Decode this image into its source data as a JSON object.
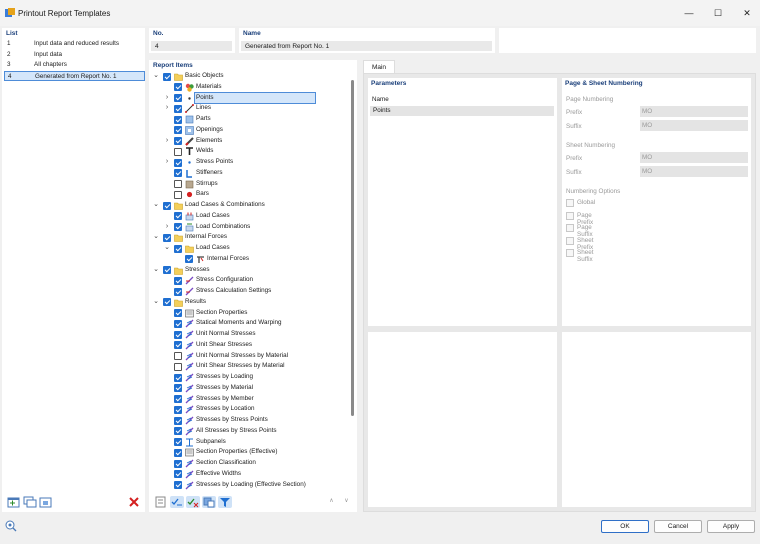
{
  "window": {
    "title": "Printout Report Templates",
    "minimize": "—",
    "maximize": "☐",
    "close": "✕"
  },
  "list": {
    "header": "List",
    "items": [
      {
        "no": "1",
        "label": "Input data and reduced results"
      },
      {
        "no": "2",
        "label": "Input data"
      },
      {
        "no": "3",
        "label": "All chapters"
      },
      {
        "no": "4",
        "label": "Generated from Report No. 1"
      }
    ],
    "selected_index": 3
  },
  "no_field": {
    "label": "No.",
    "value": "4"
  },
  "name_field": {
    "label": "Name",
    "value": "Generated from Report No. 1"
  },
  "report_items": {
    "header": "Report Items",
    "rows": [
      {
        "level": 0,
        "exp": "v",
        "checked": true,
        "icon": "folder-icon",
        "label": "Basic Objects"
      },
      {
        "level": 1,
        "exp": "",
        "checked": true,
        "icon": "materials-icon",
        "label": "Materials"
      },
      {
        "level": 1,
        "exp": ">",
        "checked": true,
        "icon": "point-icon",
        "label": "Points",
        "highlight": true
      },
      {
        "level": 1,
        "exp": ">",
        "checked": true,
        "icon": "line-icon",
        "label": "Lines"
      },
      {
        "level": 1,
        "exp": "",
        "checked": true,
        "icon": "parts-icon",
        "label": "Parts"
      },
      {
        "level": 1,
        "exp": "",
        "checked": true,
        "icon": "openings-icon",
        "label": "Openings"
      },
      {
        "level": 1,
        "exp": ">",
        "checked": true,
        "icon": "elements-icon",
        "label": "Elements"
      },
      {
        "level": 1,
        "exp": "",
        "checked": false,
        "icon": "welds-icon",
        "label": "Welds"
      },
      {
        "level": 1,
        "exp": ">",
        "checked": true,
        "icon": "stress-point-icon",
        "label": "Stress Points"
      },
      {
        "level": 1,
        "exp": "",
        "checked": true,
        "icon": "stiffeners-icon",
        "label": "Stiffeners"
      },
      {
        "level": 1,
        "exp": "",
        "checked": false,
        "icon": "stirrups-icon",
        "label": "Stirrups"
      },
      {
        "level": 1,
        "exp": "",
        "checked": false,
        "icon": "bars-icon",
        "label": "Bars"
      },
      {
        "level": 0,
        "exp": "v",
        "checked": true,
        "icon": "folder-icon",
        "label": "Load Cases & Combinations"
      },
      {
        "level": 1,
        "exp": "",
        "checked": true,
        "icon": "load-cases-icon",
        "label": "Load Cases"
      },
      {
        "level": 1,
        "exp": ">",
        "checked": true,
        "icon": "load-combinations-icon",
        "label": "Load Combinations"
      },
      {
        "level": 0,
        "exp": "v",
        "checked": true,
        "icon": "folder-icon",
        "label": "Internal Forces"
      },
      {
        "level": 1,
        "exp": "v",
        "checked": true,
        "icon": "folder-icon",
        "label": "Load Cases"
      },
      {
        "level": 2,
        "exp": "",
        "checked": true,
        "icon": "internal-forces-icon",
        "label": "Internal Forces"
      },
      {
        "level": 0,
        "exp": "v",
        "checked": true,
        "icon": "folder-icon",
        "label": "Stresses"
      },
      {
        "level": 1,
        "exp": "",
        "checked": true,
        "icon": "stress-config-icon",
        "label": "Stress Configuration"
      },
      {
        "level": 1,
        "exp": "",
        "checked": true,
        "icon": "stress-config-icon",
        "label": "Stress Calculation Settings"
      },
      {
        "level": 0,
        "exp": "v",
        "checked": true,
        "icon": "folder-icon",
        "label": "Results"
      },
      {
        "level": 1,
        "exp": "",
        "checked": true,
        "icon": "section-properties-icon",
        "label": "Section Properties"
      },
      {
        "level": 1,
        "exp": "",
        "checked": true,
        "icon": "stress-result-icon",
        "label": "Statical Moments and Warping"
      },
      {
        "level": 1,
        "exp": "",
        "checked": true,
        "icon": "stress-result-icon",
        "label": "Unit Normal Stresses"
      },
      {
        "level": 1,
        "exp": "",
        "checked": true,
        "icon": "stress-result-icon",
        "label": "Unit Shear Stresses"
      },
      {
        "level": 1,
        "exp": "",
        "checked": false,
        "icon": "stress-result-icon",
        "label": "Unit Normal Stresses by Material"
      },
      {
        "level": 1,
        "exp": "",
        "checked": false,
        "icon": "stress-result-icon",
        "label": "Unit Shear Stresses by Material"
      },
      {
        "level": 1,
        "exp": "",
        "checked": true,
        "icon": "stress-result-icon",
        "label": "Stresses by Loading"
      },
      {
        "level": 1,
        "exp": "",
        "checked": true,
        "icon": "stress-result-icon",
        "label": "Stresses by Material"
      },
      {
        "level": 1,
        "exp": "",
        "checked": true,
        "icon": "stress-result-icon",
        "label": "Stresses by Member"
      },
      {
        "level": 1,
        "exp": "",
        "checked": true,
        "icon": "stress-result-icon",
        "label": "Stresses by Location"
      },
      {
        "level": 1,
        "exp": "",
        "checked": true,
        "icon": "stress-result-icon",
        "label": "Stresses by Stress Points"
      },
      {
        "level": 1,
        "exp": "",
        "checked": true,
        "icon": "stress-result-icon",
        "label": "All Stresses by Stress Points"
      },
      {
        "level": 1,
        "exp": "",
        "checked": true,
        "icon": "subpanels-icon",
        "label": "Subpanels"
      },
      {
        "level": 1,
        "exp": "",
        "checked": true,
        "icon": "section-properties-icon",
        "label": "Section Properties (Effective)"
      },
      {
        "level": 1,
        "exp": "",
        "checked": true,
        "icon": "stress-result-icon",
        "label": "Section Classification"
      },
      {
        "level": 1,
        "exp": "",
        "checked": true,
        "icon": "stress-result-icon",
        "label": "Effective Widths"
      },
      {
        "level": 1,
        "exp": "",
        "checked": true,
        "icon": "stress-result-icon",
        "label": "Stresses by Loading (Effective Section)"
      }
    ]
  },
  "main_tab": "Main",
  "parameters": {
    "header": "Parameters",
    "name_label": "Name",
    "value": "Points"
  },
  "numbering": {
    "header": "Page & Sheet Numbering",
    "page_header": "Page Numbering",
    "prefix_label": "Prefix",
    "suffix_label": "Suffix",
    "page_prefix": "MO",
    "page_suffix": "MO",
    "sheet_header": "Sheet Numbering",
    "sheet_prefix": "MO",
    "sheet_suffix": "MO",
    "options_header": "Numbering Options",
    "options": [
      "Global",
      "Page Prefix",
      "Page Suffix",
      "Sheet Prefix",
      "Sheet Suffix"
    ]
  },
  "buttons": {
    "ok": "OK",
    "cancel": "Cancel",
    "apply": "Apply"
  },
  "colors": {
    "accent": "#1f6fd1",
    "header": "#1a3f7a",
    "selection": "#d4e6fa"
  }
}
